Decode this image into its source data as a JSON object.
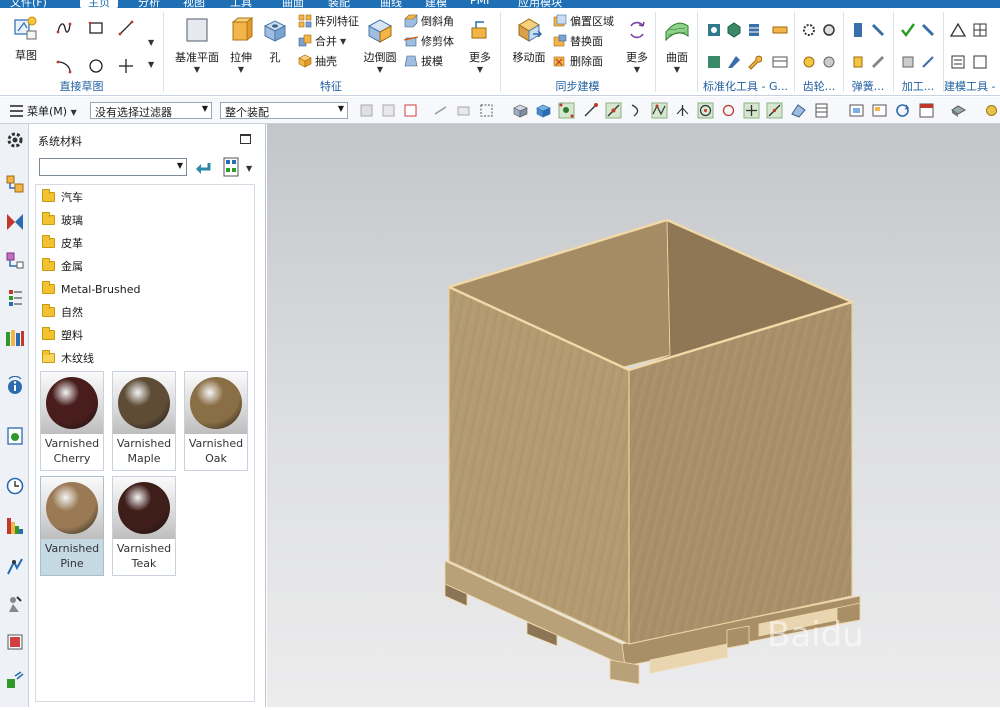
{
  "menu": {
    "tabs": [
      "文件(F)",
      "主页",
      "分析",
      "视图",
      "工具",
      "曲面",
      "装配",
      "曲线",
      "建模",
      "PMI",
      "应用模块"
    ],
    "active": "主页"
  },
  "ribbon": {
    "direct_sketch": {
      "label": "直接草图",
      "sketch_label": "草图"
    },
    "feature": {
      "label": "特征",
      "datum_plane": "基准平面",
      "extrude": "拉伸",
      "hole": "孔",
      "pattern_feature": "阵列特征",
      "unite": "合并",
      "shell": "抽壳",
      "edge_blend": "边倒圆",
      "chamfer": "倒斜角",
      "trim_body": "修剪体",
      "draft": "拔模",
      "more": "更多"
    },
    "sync_modeling": {
      "label": "同步建模",
      "move_face": "移动面",
      "offset_region": "偏置区域",
      "replace_face": "替换面",
      "delete_face": "删除面",
      "more": "更多"
    },
    "surface": {
      "curve_face": "曲面"
    },
    "groups_right": {
      "standard_tools": "标准化工具 - G...",
      "gear": "齿轮...",
      "spring": "弹簧...",
      "machining": "加工...",
      "modeling_tools": "建模工具 - ..."
    }
  },
  "selbar": {
    "menu_label": "菜单(M)",
    "filter": "没有选择过滤器",
    "scope": "整个装配"
  },
  "panel": {
    "title": "系统材料",
    "combo_value": "",
    "folders": [
      "汽车",
      "玻璃",
      "皮革",
      "金属",
      "Metal-Brushed",
      "自然",
      "塑料",
      "木纹线"
    ],
    "materials": [
      {
        "line1": "Varnished",
        "line2": "Cherry",
        "color": "#4a1d1d"
      },
      {
        "line1": "Varnished",
        "line2": "Maple",
        "color": "#5e4c36"
      },
      {
        "line1": "Varnished",
        "line2": "Oak",
        "color": "#8a6e45"
      },
      {
        "line1": "Varnished",
        "line2": "Pine",
        "color": "#9a7a55"
      },
      {
        "line1": "Varnished",
        "line2": "Teak",
        "color": "#3f1e1a"
      }
    ],
    "selected_material": "Varnished Pine"
  },
  "model": {
    "wood_color": "#b39a70",
    "edge_color": "#f1d9a8",
    "watermark": "Baidu"
  }
}
